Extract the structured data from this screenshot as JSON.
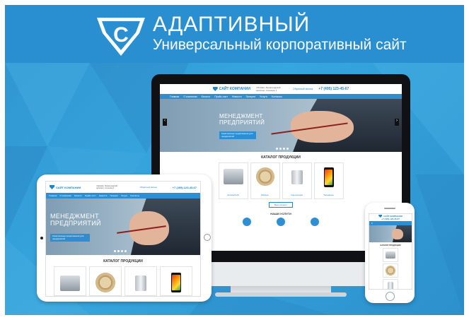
{
  "banner": {
    "title": "АДАПТИВНЫЙ",
    "subtitle": "Универсальный корпоративный сайт",
    "colors": {
      "background": "#2f93cf",
      "accent": "#1f86c8",
      "text": "#ffffff"
    },
    "logo_icon": "shield-s-icon"
  },
  "site": {
    "brand": "САЙТ КОМПАНИИ",
    "address": "г.Москва, Ленинградский проспект, строение 1",
    "phone": "+7 (495) 123-45-67",
    "callback": "Обратный звонок",
    "nav": [
      "Главная",
      "О компании",
      "Каталог",
      "Прайс-лист",
      "Новости",
      "Галерея",
      "Услуги",
      "Контакты"
    ],
    "hero": {
      "title_line1": "МЕНЕДЖМЕНТ",
      "title_line2": "ПРЕДПРИЯТИЙ",
      "button": "Комплексные предложения для предприятий"
    },
    "catalog_title": "КАТАЛОГ ПРОДУКЦИИ",
    "catalog_items": [
      "Автомобили",
      "Мебель",
      "Сантехника",
      "Телефоны"
    ],
    "all_catalog_button": "Весь каталог",
    "services_title": "НАШИ УСЛУГИ"
  }
}
